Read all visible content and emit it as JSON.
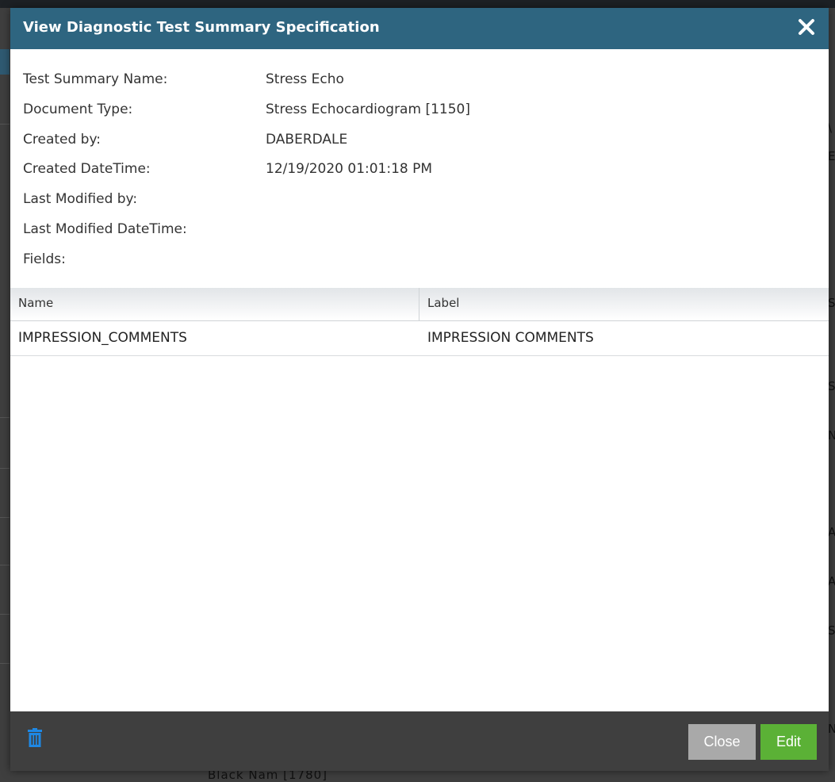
{
  "dialog": {
    "title": "View Diagnostic Test Summary Specification"
  },
  "info": [
    {
      "label": "Test Summary Name:",
      "value": "Stress Echo"
    },
    {
      "label": "Document Type:",
      "value": "Stress Echocardiogram [1150]"
    },
    {
      "label": "Created by:",
      "value": "DABERDALE"
    },
    {
      "label": "Created DateTime:",
      "value": "12/19/2020 01:01:18 PM"
    },
    {
      "label": "Last Modified by:",
      "value": ""
    },
    {
      "label": "Last Modified DateTime:",
      "value": ""
    },
    {
      "label": "Fields:",
      "value": ""
    }
  ],
  "grid": {
    "columns": [
      "Name",
      "Label"
    ],
    "rows": [
      [
        "IMPRESSION_COMMENTS",
        "IMPRESSION COMMENTS"
      ]
    ]
  },
  "footer": {
    "close_label": "Close",
    "edit_label": "Edit",
    "trash_color": "#1e88e5",
    "edit_color": "#5bb136",
    "close_color": "#a9a9a9"
  },
  "background": {
    "side_chars": [
      "\\",
      "E",
      "S",
      "S",
      "N",
      "A",
      "A",
      "S",
      "N"
    ],
    "bottom_text": "Black Nam [1780]"
  },
  "colors": {
    "header": "#2e6580"
  }
}
